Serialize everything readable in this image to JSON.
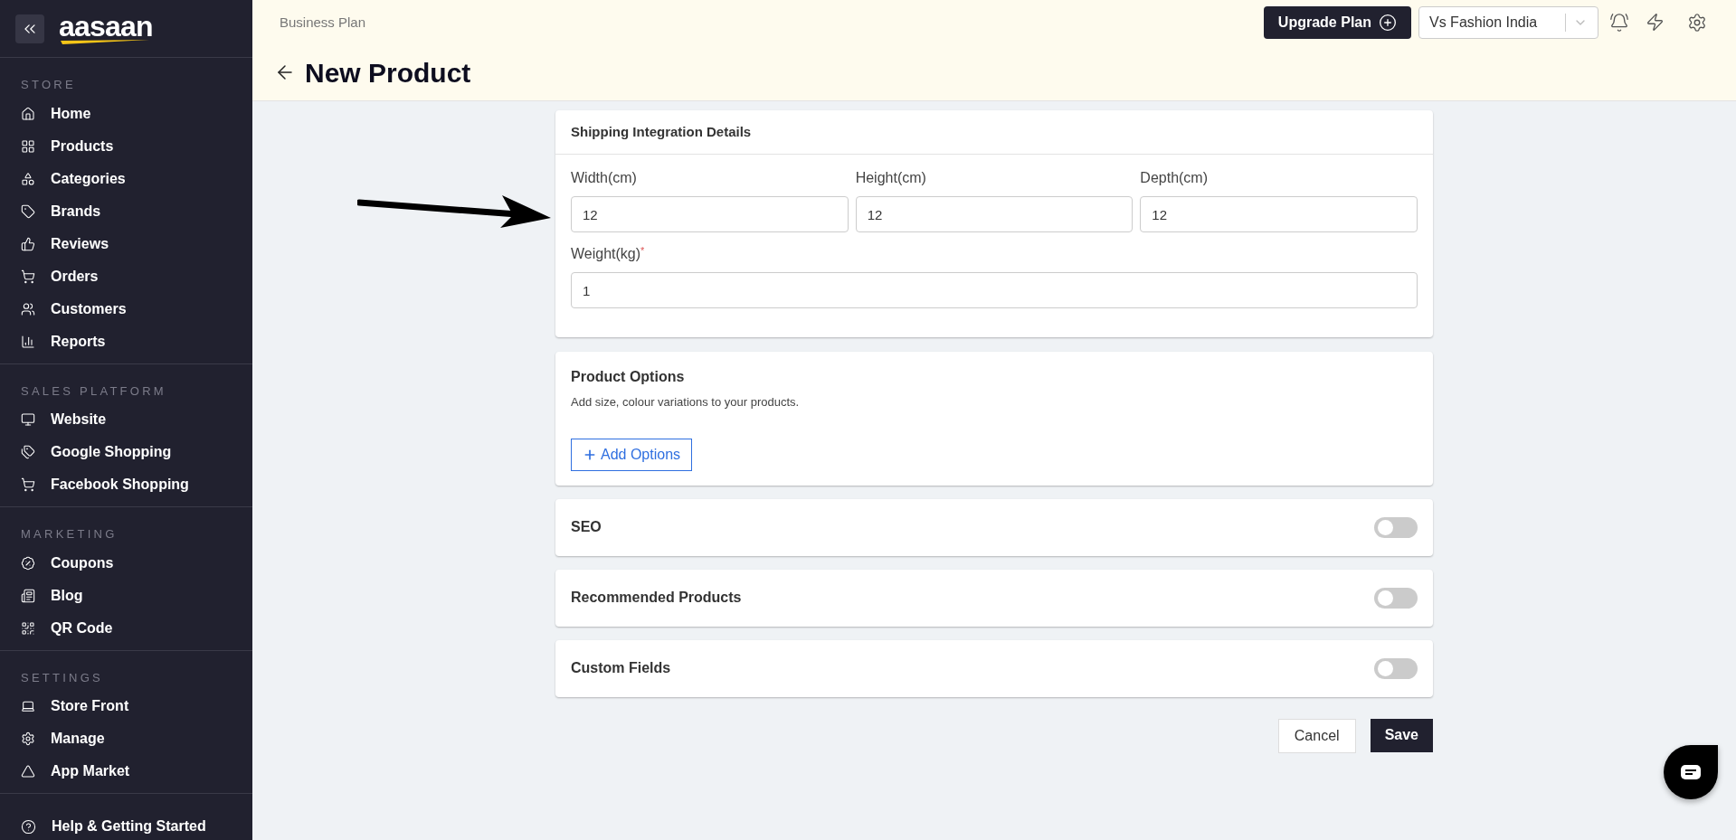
{
  "sidebar": {
    "logo": "aasaan",
    "sections": [
      {
        "label": "STORE",
        "items": [
          {
            "label": "Home"
          },
          {
            "label": "Products"
          },
          {
            "label": "Categories"
          },
          {
            "label": "Brands"
          },
          {
            "label": "Reviews"
          },
          {
            "label": "Orders"
          },
          {
            "label": "Customers"
          },
          {
            "label": "Reports"
          }
        ]
      },
      {
        "label": "SALES PLATFORM",
        "items": [
          {
            "label": "Website"
          },
          {
            "label": "Google Shopping"
          },
          {
            "label": "Facebook Shopping"
          }
        ]
      },
      {
        "label": "MARKETING",
        "items": [
          {
            "label": "Coupons"
          },
          {
            "label": "Blog"
          },
          {
            "label": "QR Code"
          }
        ]
      },
      {
        "label": "SETTINGS",
        "items": [
          {
            "label": "Store Front"
          },
          {
            "label": "Manage"
          },
          {
            "label": "App Market"
          }
        ]
      }
    ],
    "help": "Help & Getting Started"
  },
  "header": {
    "plan": "Business Plan",
    "upgrade_button": "Upgrade Plan",
    "store_select": "Vs Fashion India",
    "title": "New Product"
  },
  "shipping": {
    "title": "Shipping Integration Details",
    "fields": [
      {
        "label": "Width(cm)",
        "value": "12"
      },
      {
        "label": "Height(cm)",
        "value": "12"
      },
      {
        "label": "Depth(cm)",
        "value": "12"
      },
      {
        "label": "Weight(kg)",
        "required_mark": "*",
        "value": "1"
      }
    ]
  },
  "product_options": {
    "title": "Product Options",
    "description": "Add size, colour variations to your products.",
    "button": "Add Options"
  },
  "toggle_sections": [
    {
      "title": "SEO",
      "on": false
    },
    {
      "title": "Recommended Products",
      "on": false
    },
    {
      "title": "Custom Fields",
      "on": false
    }
  ],
  "actions": {
    "cancel": "Cancel",
    "save": "Save"
  }
}
